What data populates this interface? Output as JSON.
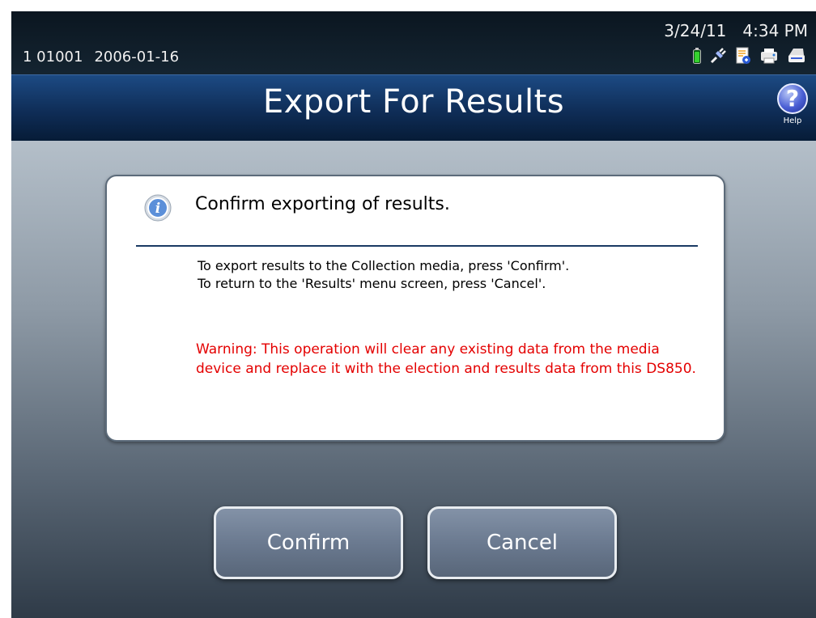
{
  "status": {
    "precinct": "1 01001",
    "election_date": "2006-01-16",
    "date": "3/24/11",
    "time": "4:34 PM",
    "icons": [
      "battery-icon",
      "power-plug-icon",
      "document-icon",
      "printer-icon",
      "scanner-icon"
    ]
  },
  "header": {
    "title": "Export For Results",
    "help_label": "Help",
    "help_glyph": "?"
  },
  "dialog": {
    "heading": "Confirm exporting of results.",
    "line1": "To export results to the Collection media, press 'Confirm'.",
    "line2": "To return to the 'Results' menu screen, press 'Cancel'.",
    "warning": "Warning:  This operation will clear any existing data from the media device and replace it with the election and results data from this DS850.",
    "warning_color": "#e40000"
  },
  "buttons": {
    "confirm_label": "Confirm",
    "cancel_label": "Cancel"
  }
}
